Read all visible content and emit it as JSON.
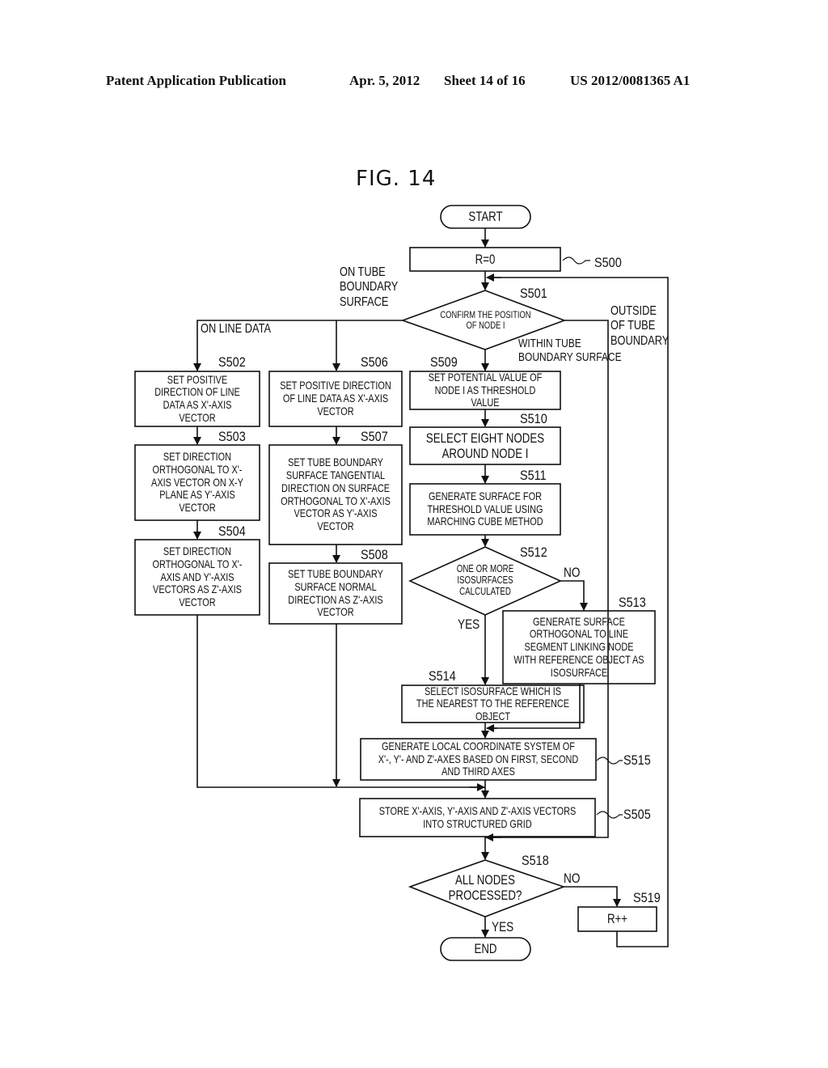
{
  "header": {
    "publication": "Patent Application Publication",
    "date": "Apr. 5, 2012",
    "sheet": "Sheet 14 of 16",
    "number": "US 2012/0081365 A1"
  },
  "figure_title": "FIG. 14",
  "nodes": {
    "start": {
      "text": "START"
    },
    "s500": {
      "step": "S500",
      "text": "r=0"
    },
    "s501": {
      "step": "S501",
      "text": "CONFIRM THE POSITION OF NODE i"
    },
    "s502": {
      "step": "S502",
      "text": "SET POSITIVE DIRECTION OF LINE DATA AS X'-AXIS VECTOR"
    },
    "s503": {
      "step": "S503",
      "text": "SET DIRECTION ORTHOGONAL TO X'-AXIS VECTOR ON X-Y PLANE AS Y'-AXIS VECTOR"
    },
    "s504": {
      "step": "S504",
      "text": "SET DIRECTION ORTHOGONAL TO X'-AXIS AND Y'-AXIS VECTORS AS Z'-AXIS VECTOR"
    },
    "s506": {
      "step": "S506",
      "text": "SET POSITIVE DIRECTION OF LINE DATA AS X'-AXIS VECTOR"
    },
    "s507": {
      "step": "S507",
      "text": "SET TUBE BOUNDARY SURFACE TANGENTIAL DIRECTION ON SURFACE ORTHOGONAL TO X'-AXIS VECTOR AS Y'-AXIS VECTOR"
    },
    "s508": {
      "step": "S508",
      "text": "SET TUBE BOUNDARY SURFACE NORMAL DIRECTION AS Z'-AXIS VECTOR"
    },
    "s509": {
      "step": "S509",
      "text": "SET POTENTIAL VALUE OF NODE i AS THRESHOLD VALUE"
    },
    "s510": {
      "step": "S510",
      "text": "SELECT EIGHT NODES AROUND NODE i"
    },
    "s511": {
      "step": "S511",
      "text": "GENERATE SURFACE FOR THRESHOLD VALUE USING MARCHING CUBE METHOD"
    },
    "s512": {
      "step": "S512",
      "text": "ONE OR MORE ISOSURFACES CALCULATED"
    },
    "s513": {
      "step": "S513",
      "text": "GENERATE SURFACE ORTHOGONAL TO LINE SEGMENT LINKING NODE WITH REFERENCE OBJECT AS ISOSURFACE"
    },
    "s514": {
      "step": "S514",
      "text": "SELECT ISOSURFACE WHICH IS THE NEAREST TO THE REFERENCE OBJECT"
    },
    "s515": {
      "step": "S515",
      "text": "GENERATE LOCAL COORDINATE SYSTEM OF X'-, Y'- AND Z'-AXES BASED ON FIRST, SECOND AND THIRD AXES"
    },
    "s505": {
      "step": "S505",
      "text": "STORE X'-AXIS, Y'-AXIS AND Z'-AXIS VECTORS INTO STRUCTURED GRID"
    },
    "s518": {
      "step": "S518",
      "text": "ALL NODES PROCESSED?"
    },
    "s519": {
      "step": "S519",
      "text": "r++"
    },
    "end": {
      "text": "END"
    }
  },
  "edge_labels": {
    "on_tube_boundary_surface": "ON TUBE\nBOUNDARY\nSURFACE",
    "on_line_data": "ON LINE DATA",
    "within_tube_boundary_surface": "WITHIN TUBE\nBOUNDARY SURFACE",
    "outside_of_tube_boundary": "OUTSIDE\nOF TUBE\nBOUNDARY",
    "s512_no": "NO",
    "s512_yes": "YES",
    "s518_no": "NO",
    "s518_yes": "YES"
  }
}
